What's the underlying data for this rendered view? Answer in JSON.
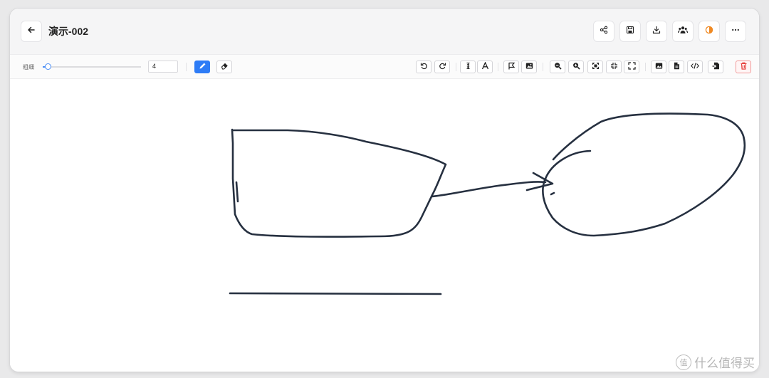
{
  "header": {
    "title": "演示-002",
    "back_icon": "arrow-left-icon",
    "actions": [
      "share-icon",
      "save-icon",
      "download-icon",
      "collaborators-icon",
      "theme-icon",
      "more-icon"
    ]
  },
  "toolbar": {
    "thickness_label": "粗细",
    "thickness_value": "4",
    "thickness_level": 0.05,
    "tools": [
      "pen-icon",
      "eraser-icon"
    ],
    "active_tool": "pen-icon",
    "accent_color": "#2e7cf6",
    "danger_color": "#e53935"
  },
  "watermark": {
    "badge": "值",
    "text": "什么值得买"
  }
}
